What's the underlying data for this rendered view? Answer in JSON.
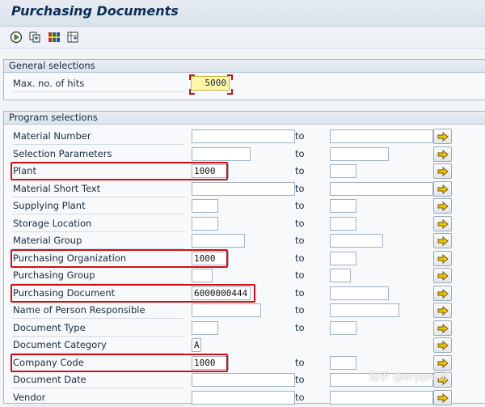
{
  "window": {
    "title": "Purchasing Documents"
  },
  "toolbar": {
    "icons": [
      "execute-icon",
      "copy-icon",
      "variant-icon",
      "dynamic-selection-icon"
    ]
  },
  "general_selections": {
    "title": "General selections",
    "max_hits_label": "Max. no. of hits",
    "max_hits_value": "5000"
  },
  "program_selections": {
    "title": "Program selections",
    "to_label": "to",
    "rows": [
      {
        "label": "Material Number",
        "low": "",
        "has_to": true
      },
      {
        "label": "Selection Parameters",
        "low": "",
        "has_to": true
      },
      {
        "label": "Plant",
        "low": "1000",
        "has_to": true,
        "highlighted": true
      },
      {
        "label": "Material Short Text",
        "low": "",
        "has_to": true
      },
      {
        "label": "Supplying Plant",
        "low": "",
        "has_to": true
      },
      {
        "label": "Storage Location",
        "low": "",
        "has_to": true
      },
      {
        "label": "Material Group",
        "low": "",
        "has_to": true
      },
      {
        "label": "Purchasing Organization",
        "low": "1000",
        "has_to": true,
        "highlighted": true
      },
      {
        "label": "Purchasing Group",
        "low": "",
        "has_to": true
      },
      {
        "label": "Purchasing Document",
        "low": "6000000444",
        "has_to": true,
        "highlighted": true
      },
      {
        "label": "Name of Person Responsible",
        "low": "",
        "has_to": true
      },
      {
        "label": "Document Type",
        "low": "",
        "has_to": true
      },
      {
        "label": "Document Category",
        "low": "A",
        "has_to": false
      },
      {
        "label": "Company Code",
        "low": "1000",
        "has_to": true,
        "highlighted": true
      },
      {
        "label": "Document Date",
        "low": "",
        "has_to": true
      },
      {
        "label": "Vendor",
        "low": "",
        "has_to": true
      }
    ]
  },
  "watermark": "知乎 @erpproof",
  "colors": {
    "highlight": "#d10f16",
    "arrow": "#f2c400",
    "title": "#0b2f56"
  }
}
